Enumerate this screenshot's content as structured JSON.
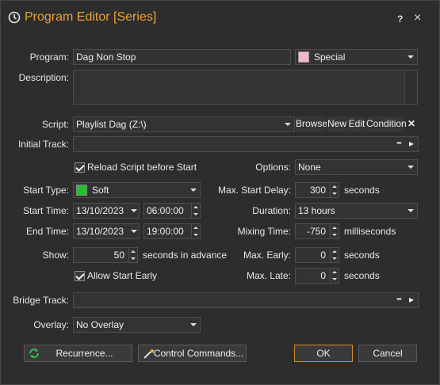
{
  "title": "Program Editor [Series]",
  "title_buttons": {
    "help": "?",
    "close": "×"
  },
  "program": {
    "label": "Program:",
    "value": "Dag Non Stop",
    "category": "Special",
    "category_color": "#f4b8c8"
  },
  "description": {
    "label": "Description:",
    "value": ""
  },
  "script": {
    "label": "Script:",
    "value": "Playlist Dag (Z:\\)",
    "browse": "Browse",
    "new": "New",
    "edit": "Edit",
    "condition": "Condition",
    "clear": "✕"
  },
  "initial_track": {
    "label": "Initial Track:",
    "value": "",
    "more": "•••",
    "play": "▸"
  },
  "reload_script": {
    "label": "Reload Script before Start",
    "checked": true
  },
  "options": {
    "label": "Options:",
    "value": "None"
  },
  "start_type": {
    "label": "Start Type:",
    "value": "Soft",
    "color": "#22c02a"
  },
  "max_start_delay": {
    "label": "Max. Start Delay:",
    "value": "300",
    "unit": "seconds"
  },
  "start_time": {
    "label": "Start Time:",
    "date": "13/10/2023",
    "time": "06:00:00"
  },
  "duration": {
    "label": "Duration:",
    "value": "13 hours"
  },
  "end_time": {
    "label": "End Time:",
    "date": "13/10/2023",
    "time": "19:00:00"
  },
  "mixing_time": {
    "label": "Mixing Time:",
    "value": "-750",
    "unit": "milliseconds"
  },
  "show": {
    "label": "Show:",
    "value": "50",
    "unit": "seconds in advance"
  },
  "max_early": {
    "label": "Max. Early:",
    "value": "0",
    "unit": "seconds"
  },
  "allow_start_early": {
    "label": "Allow Start Early",
    "checked": true
  },
  "max_late": {
    "label": "Max. Late:",
    "value": "0",
    "unit": "seconds"
  },
  "bridge_track": {
    "label": "Bridge Track:",
    "value": "",
    "more": "•••",
    "play": "▸"
  },
  "overlay": {
    "label": "Overlay:",
    "value": "No Overlay"
  },
  "buttons": {
    "recurrence": "Recurrence...",
    "control_commands": "Control Commands...",
    "ok": "OK",
    "cancel": "Cancel"
  },
  "colors": {
    "accent": "#e8a23a",
    "ok_border": "#d58b2a"
  }
}
